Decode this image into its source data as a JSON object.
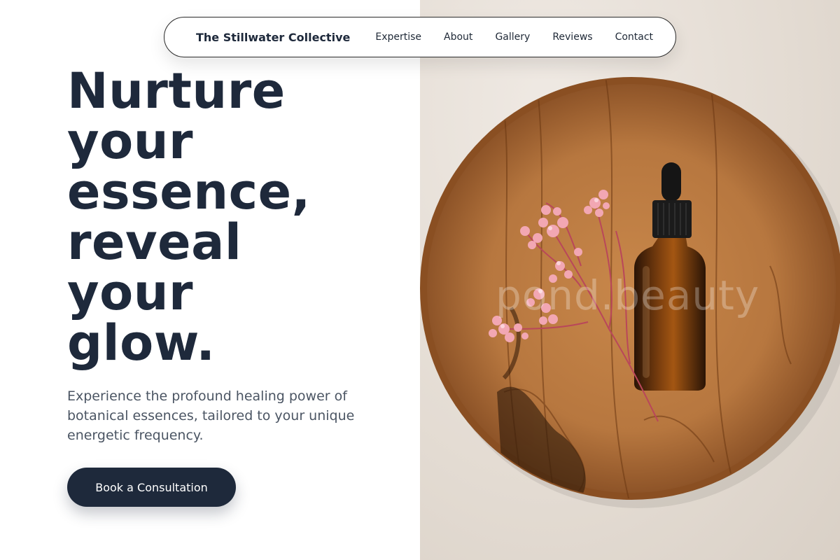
{
  "nav": {
    "brand": "The Stillwater Collective",
    "links": [
      "Expertise",
      "About",
      "Gallery",
      "Reviews",
      "Contact"
    ]
  },
  "hero": {
    "headline_lines": [
      "Nurture",
      "your",
      "essence,",
      "reveal",
      "your",
      "glow."
    ],
    "subtext": "Experience the profound healing power of botanical essences, tailored to your unique energetic frequency.",
    "cta_label": "Book a Consultation"
  },
  "image": {
    "watermark": "pond.beauty"
  },
  "colors": {
    "primary": "#1e293b",
    "text_muted": "#4b5563",
    "wood": "#b7773f",
    "flower": "#f2a7b3"
  }
}
